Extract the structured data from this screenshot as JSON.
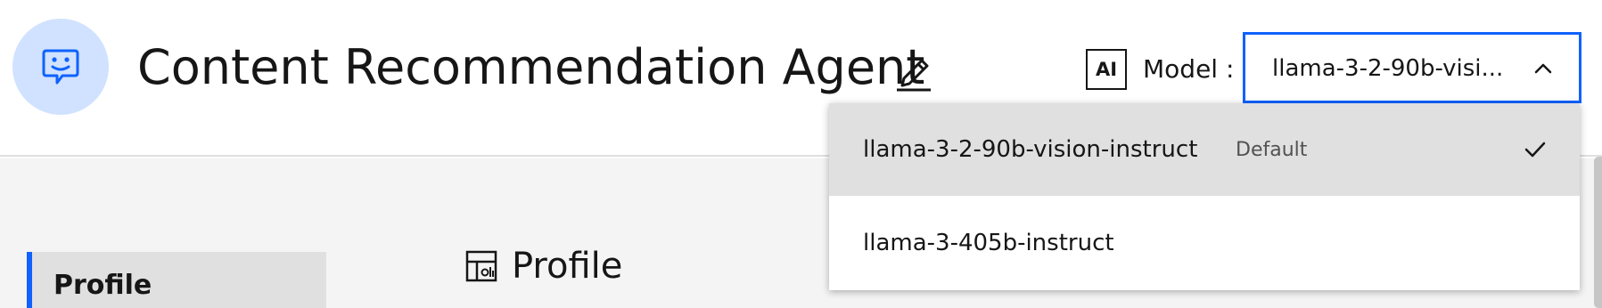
{
  "header": {
    "title": "Content Recommendation Agent",
    "ai_badge": "AI",
    "model_label": "Model :",
    "model_select_value": "llama-3-2-90b-visi..."
  },
  "model_options": [
    {
      "label": "llama-3-2-90b-vision-instruct",
      "tag": "Default",
      "selected": true
    },
    {
      "label": "llama-3-405b-instruct",
      "selected": false
    }
  ],
  "sidebar": {
    "items": [
      {
        "label": "Profile",
        "active": true
      }
    ]
  },
  "main": {
    "section_title": "Profile"
  },
  "colors": {
    "accent": "#0f62fe",
    "avatar_bg": "#d0e2ff",
    "selected_option_bg": "#e0e0e0",
    "page_bg": "#f4f4f4"
  },
  "icons": {
    "avatar": "chat-bot-icon",
    "edit": "pencil-icon",
    "select": "chevron-up-icon",
    "selected": "checkmark-icon",
    "section": "profile-icon"
  }
}
